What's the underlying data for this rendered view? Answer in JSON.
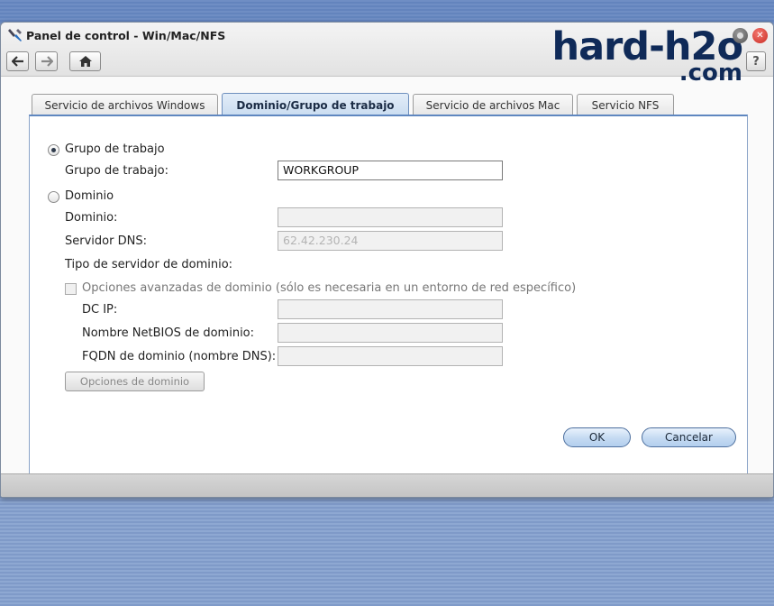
{
  "window": {
    "title": "Panel de control - Win/Mac/NFS",
    "help_label": "?"
  },
  "watermark": {
    "main": "hard-h2o",
    "sub": ".com"
  },
  "tabs": [
    {
      "label": "Servicio de archivos Windows",
      "active": false
    },
    {
      "label": "Dominio/Grupo de trabajo",
      "active": true
    },
    {
      "label": "Servicio de archivos Mac",
      "active": false
    },
    {
      "label": "Servicio NFS",
      "active": false
    }
  ],
  "form": {
    "workgroup_radio_label": "Grupo de trabajo",
    "workgroup_label": "Grupo de trabajo:",
    "workgroup_value": "WORKGROUP",
    "domain_radio_label": "Dominio",
    "domain_label": "Dominio:",
    "domain_value": "",
    "dns_label": "Servidor DNS:",
    "dns_value": "62.42.230.24",
    "server_type_label": "Tipo de servidor de dominio:",
    "advanced_label": "Opciones avanzadas de dominio (sólo es necesaria en un entorno de red específico)",
    "dcip_label": "DC IP:",
    "dcip_value": "",
    "netbios_label": "Nombre NetBIOS de dominio:",
    "netbios_value": "",
    "fqdn_label": "FQDN de dominio (nombre DNS):",
    "fqdn_value": "",
    "domain_options_button": "Opciones de dominio",
    "selected_mode": "workgroup"
  },
  "buttons": {
    "ok": "OK",
    "cancel": "Cancelar"
  },
  "colors": {
    "accent": "#5f87c0",
    "watermark": "#0f2a58",
    "close": "#e0403a"
  }
}
